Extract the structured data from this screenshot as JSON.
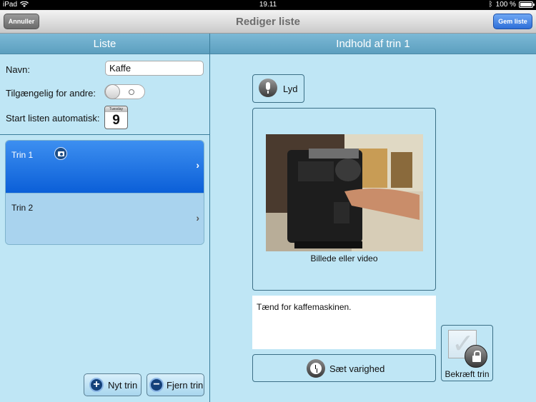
{
  "status_bar": {
    "device": "iPad",
    "time": "19.11",
    "battery": "100 %"
  },
  "nav": {
    "cancel_label": "Annuller",
    "title": "Rediger liste",
    "save_label": "Gem liste"
  },
  "left": {
    "header": "Liste",
    "name_label": "Navn:",
    "name_value": "Kaffe",
    "shared_label": "Tilgængelig for andre:",
    "autostart_label": "Start listen automatisk:",
    "calendar": {
      "weekday": "Tuesday",
      "day": "9"
    },
    "steps": [
      {
        "label": "Trin 1",
        "has_photo": true,
        "selected": true
      },
      {
        "label": "Trin 2",
        "has_photo": false,
        "selected": false
      }
    ],
    "new_step_label": "Nyt trin",
    "remove_step_label": "Fjern trin"
  },
  "right": {
    "header": "Indhold af trin 1",
    "sound_label": "Lyd",
    "media_caption": "Billede eller video",
    "step_text": "Tænd for kaffemaskinen.",
    "duration_label": "Sæt varighed",
    "confirm_label": "Bekræft trin"
  },
  "colors": {
    "selected_row": "#0b5fd8",
    "header_bar": "#6aaccb",
    "background": "#bfe6f5",
    "save_button": "#2e6fd8"
  },
  "icons": [
    "wifi-icon",
    "bluetooth-icon",
    "battery-icon",
    "camera-icon",
    "chevron-right-icon",
    "microphone-icon",
    "clock-icon",
    "plus-icon",
    "minus-icon",
    "lock-icon",
    "checkbox-icon"
  ]
}
